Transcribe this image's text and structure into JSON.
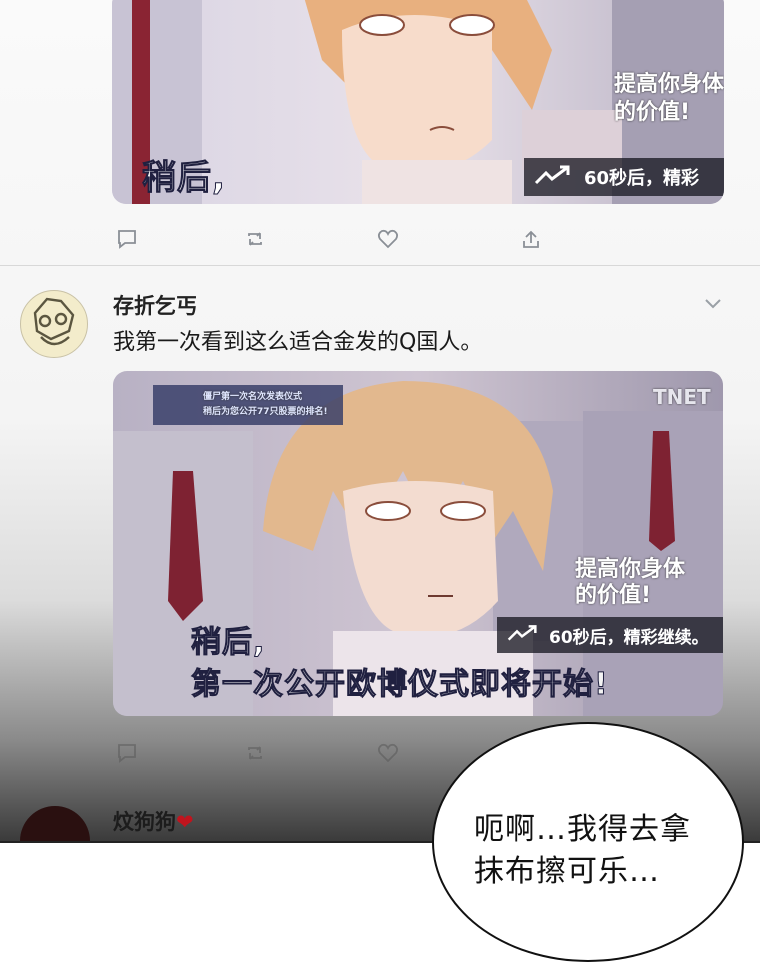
{
  "post1": {
    "image": {
      "caption_later": "稍后,",
      "boost_text": "提高你身体",
      "boost_text2": "的价值!",
      "rate_text": "60秒后，精彩"
    }
  },
  "post2": {
    "username": "存折乞丐",
    "text": "我第一次看到这么适合金发的Q国人。",
    "image": {
      "caption_later": "稍后,",
      "caption_main": "第一次公开欧博仪式即将开始!",
      "boost_text": "提高你身体",
      "boost_text2": "的价值!",
      "rate_text": "60秒后，精彩继续。",
      "watermark": "TNET",
      "banner_line1": "僵尸第一次名次发表仪式",
      "banner_line2": "稍后为您公开77只股票的排名!"
    }
  },
  "post3": {
    "username": "炆狗狗",
    "heart": "❤"
  },
  "speech_bubble": {
    "line1": "呃啊…我得去拿",
    "line2": "抹布擦可乐…"
  },
  "icons": {
    "reply": "comment-icon",
    "retweet": "retweet-icon",
    "like": "heart-icon",
    "share": "share-icon",
    "more": "chevron-down-icon"
  }
}
